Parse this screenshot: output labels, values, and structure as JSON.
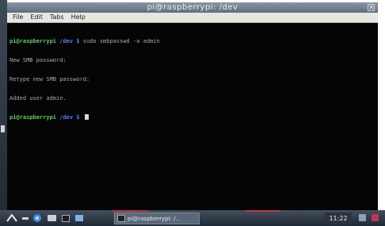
{
  "window": {
    "title": "pi@raspberrypi: /dev",
    "close_glyph": "×"
  },
  "menu": {
    "items": [
      "File",
      "Edit",
      "Tabs",
      "Help"
    ]
  },
  "terminal": {
    "lines": [
      {
        "user": "pi@raspberrypi",
        "path": " /dev $",
        "text": " sudo smbpasswd -a admin"
      },
      {
        "text": "New SMB password:"
      },
      {
        "text": "Retype new SMB password:"
      },
      {
        "text": "Added user admin."
      },
      {
        "user": "pi@raspberrypi",
        "path": " /dev $",
        "text": " "
      }
    ],
    "colors": {
      "user": "#5ad15a",
      "path": "#5b7cf0",
      "text": "#a9a9a9"
    }
  },
  "taskbar": {
    "task_label": "pi@raspberrypi: /...",
    "clock": "11:22",
    "icons": [
      "menu-icon",
      "minimize-icon",
      "browser-icon",
      "files-icon",
      "terminal-icon",
      "desktop-icon"
    ],
    "accent": "#c0364d"
  }
}
